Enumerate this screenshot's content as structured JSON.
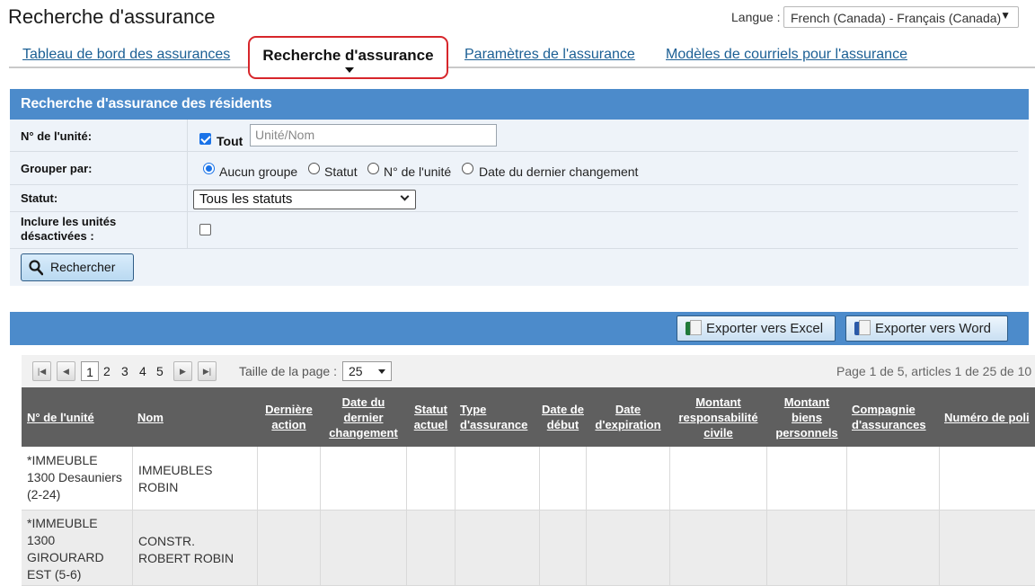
{
  "header": {
    "title": "Recherche d'assurance",
    "language_label": "Langue :",
    "language_value": "French (Canada) - Français (Canada)"
  },
  "tabs": [
    {
      "label": "Tableau de bord des assurances",
      "active": false
    },
    {
      "label": "Recherche d'assurance",
      "active": true
    },
    {
      "label": "Paramètres de l'assurance",
      "active": false
    },
    {
      "label": "Modèles de courriels pour l'assurance",
      "active": false
    }
  ],
  "search_panel": {
    "title": "Recherche d'assurance des résidents",
    "unit_label": "N° de l'unité:",
    "all_checkbox_label": "Tout",
    "all_checked": true,
    "unit_placeholder": "Unité/Nom",
    "group_label": "Grouper par:",
    "group_options": [
      "Aucun groupe",
      "Statut",
      "N° de l'unité",
      "Date du dernier changement"
    ],
    "group_selected": "Aucun groupe",
    "status_label": "Statut:",
    "status_value": "Tous les statuts",
    "inactive_label_line1": "Inclure les unités",
    "inactive_label_line2": "désactivées :",
    "inactive_checked": false,
    "search_button": "Rechercher"
  },
  "results": {
    "export_excel": "Exporter vers Excel",
    "export_word": "Exporter vers Word",
    "pager": {
      "pages": [
        "1",
        "2",
        "3",
        "4",
        "5"
      ],
      "current_page": "1",
      "page_size_label": "Taille de la page :",
      "page_size": "25",
      "info": "Page 1 de 5, articles 1 de 25 de 10"
    },
    "columns": [
      "N° de l'unité",
      "Nom",
      "Dernière action",
      "Date du dernier changement",
      "Statut actuel",
      "Type d'assurance",
      "Date de début",
      "Date d'expiration",
      "Montant responsabilité civile",
      "Montant biens personnels",
      "Compagnie d'assurances",
      "Numéro de poli"
    ],
    "rows": [
      {
        "unit": "*IMMEUBLE 1300 Desauniers (2-24)",
        "name": "IMMEUBLES ROBIN"
      },
      {
        "unit": "*IMMEUBLE 1300 GIROURARD EST (5-6)",
        "name": "CONSTR. ROBERT ROBIN"
      }
    ]
  },
  "colors": {
    "accent_blue": "#4c8bcb",
    "tab_highlight": "#d7262b",
    "link": "#1b5f94",
    "grid_header": "#5f5f5f"
  }
}
